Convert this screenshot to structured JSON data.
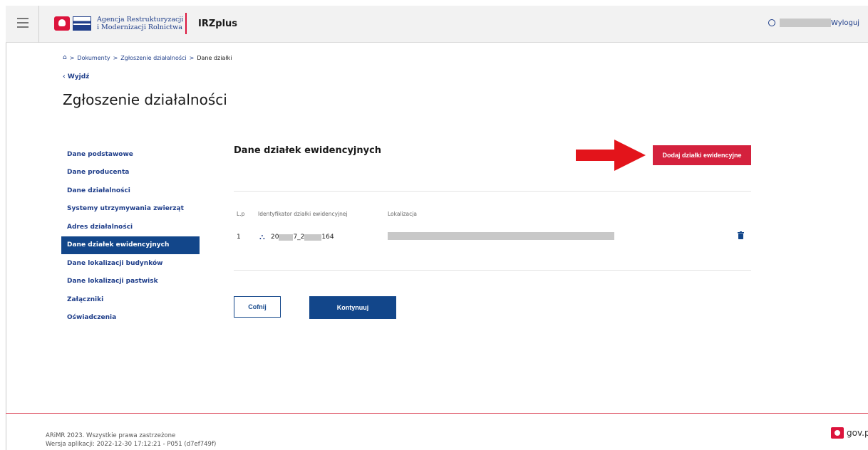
{
  "header": {
    "agency_line1": "Agencja Restrukturyzacji",
    "agency_line2": "i Modernizacji Rolnictwa",
    "app_name": "IRZplus",
    "logout_label": "Wyloguj"
  },
  "breadcrumb": {
    "items": [
      "Dokumenty",
      "Zgłoszenie działalności"
    ],
    "current": "Dane działki",
    "separator": ">"
  },
  "back_link": "‹  Wyjdź",
  "page_title": "Zgłoszenie działalności",
  "sidebar": {
    "items": [
      {
        "label": "Dane podstawowe"
      },
      {
        "label": "Dane producenta"
      },
      {
        "label": "Dane działalności"
      },
      {
        "label": "Systemy utrzymywania zwierząt"
      },
      {
        "label": "Adres działalności"
      },
      {
        "label": "Dane działek ewidencyjnych"
      },
      {
        "label": "Dane lokalizacji budynków"
      },
      {
        "label": "Dane lokalizacji pastwisk"
      },
      {
        "label": "Załączniki"
      },
      {
        "label": "Oświadczenia"
      }
    ],
    "active_index": 5
  },
  "main": {
    "section_title": "Dane działek ewidencyjnych",
    "add_button": "Dodaj działki ewidencyjne",
    "table": {
      "headers": [
        "L.p",
        "Identyfikator działki ewidencyjnej",
        "Lokalizacja"
      ],
      "rows": [
        {
          "lp": "1",
          "id_start": "20",
          "id_mid": "7_2",
          "id_end": "164"
        }
      ]
    },
    "back_button": "Cofnij",
    "next_button": "Kontynuuj"
  },
  "footer": {
    "copyright": "ARiMR 2023. Wszystkie prawa zastrzeżone",
    "version": "Wersja aplikacji: 2022-12-30 17:12:21 - P051 (d7ef749f)",
    "gov_label": "gov.p"
  },
  "colors": {
    "primary": "#12468a",
    "accent_red": "#d4213d",
    "arrow_red": "#e3141b"
  },
  "icons": {
    "menu": "hamburger-icon",
    "user": "user-circle-icon",
    "home": "home-icon",
    "plot": "map-parcel-icon",
    "delete": "trash-icon"
  }
}
